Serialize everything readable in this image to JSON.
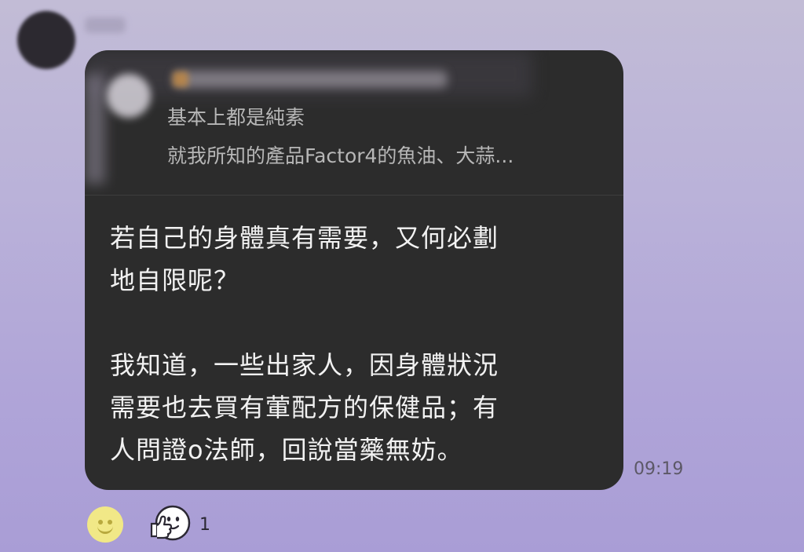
{
  "quoted_message": {
    "line1": "基本上都是純素",
    "line2": "就我所知的產品Factor4的魚油、大蒜..."
  },
  "message": {
    "paragraphs": [
      [
        "若自己的身體真有需要，又何必劃",
        "地自限呢？"
      ],
      [
        "我知道，一些出家人，因身體狀況",
        "需要也去買有葷配方的保健品；有",
        "人問證o法師，回說當藥無妨。"
      ]
    ]
  },
  "timestamp": "09:19",
  "reactions": {
    "add_reaction_icon": "smiley-icon",
    "thumbs_up_icon": "thumbs-up-face-icon",
    "count": "1"
  },
  "colors": {
    "background": "#b0a5d8",
    "bubble": "#2c2c2c",
    "message_text": "#f2f2f2",
    "quoted_text": "#b7b7b7",
    "smiley": "#f1e887"
  }
}
